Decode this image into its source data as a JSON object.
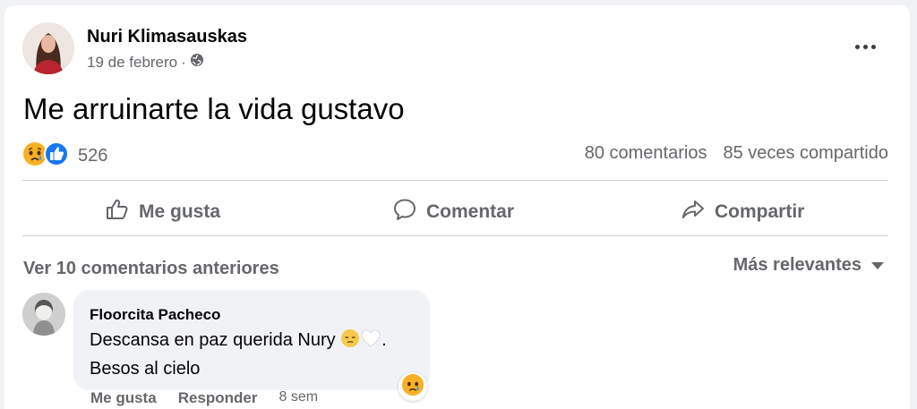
{
  "post": {
    "author": "Nuri Klimasauskas",
    "date": "19 de febrero",
    "date_separator": "·",
    "privacy_icon": "globe-icon",
    "text": "Me arruinarte la vida gustavo"
  },
  "reactions": {
    "icons": [
      "sad-reaction-icon",
      "like-reaction-icon"
    ],
    "count": "526"
  },
  "stats": {
    "comments": "80 comentarios",
    "shares": "85 veces compartido"
  },
  "actions": {
    "like": "Me gusta",
    "comment": "Comentar",
    "share": "Compartir"
  },
  "comments_section": {
    "previous": "Ver 10 comentarios anteriores",
    "sort": "Más relevantes"
  },
  "comment": {
    "author": "Floorcita Pacheco",
    "line1": "Descansa en paz querida Nury",
    "line1_end": ".",
    "line2": "Besos al cielo",
    "reaction_icon": "sad-reaction-icon",
    "like_label": "Me gusta",
    "reply_label": "Responder",
    "time": "8 sem"
  },
  "colors": {
    "like_blue": "#1877f2",
    "secondary_text": "#65676b",
    "sad_yellow": "#f7b125"
  }
}
